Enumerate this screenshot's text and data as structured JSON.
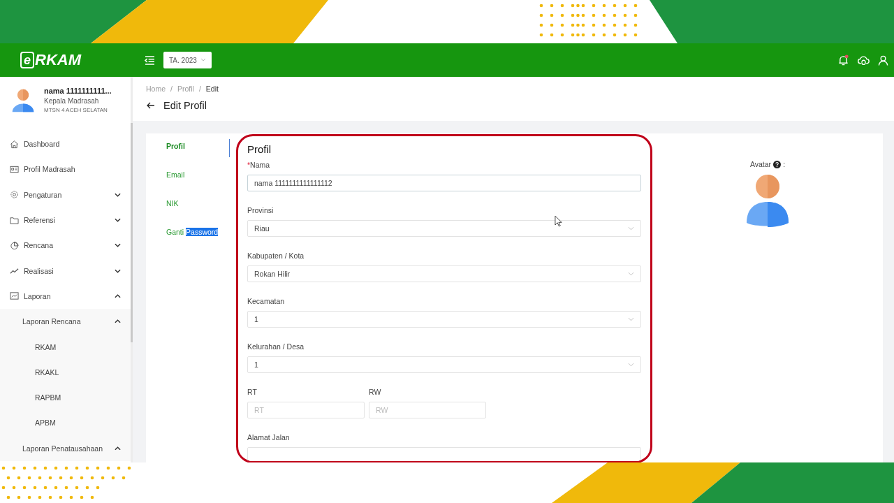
{
  "header": {
    "logo_mark": "e",
    "logo_text": "RKAM",
    "year_select": "TA. 2023",
    "notification_unread": true
  },
  "user": {
    "name": "nama 1111111111...",
    "role": "Kepala Madrasah",
    "school": "MTSN 4 ACEH SELATAN"
  },
  "sidebar": {
    "items": [
      {
        "label": "Dashboard",
        "kind": "link"
      },
      {
        "label": "Profil Madrasah",
        "kind": "link"
      },
      {
        "label": "Pengaturan",
        "kind": "group",
        "expanded": false
      },
      {
        "label": "Referensi",
        "kind": "group",
        "expanded": false
      },
      {
        "label": "Rencana",
        "kind": "group",
        "expanded": false
      },
      {
        "label": "Realisasi",
        "kind": "group",
        "expanded": false
      },
      {
        "label": "Laporan",
        "kind": "group",
        "expanded": true,
        "children": [
          {
            "label": "Laporan Rencana",
            "kind": "group",
            "expanded": true,
            "children": [
              {
                "label": "RKAM"
              },
              {
                "label": "RKAKL"
              },
              {
                "label": "RAPBM"
              },
              {
                "label": "APBM"
              }
            ]
          },
          {
            "label": "Laporan Penatausahaan",
            "kind": "group",
            "expanded": true
          }
        ]
      }
    ]
  },
  "breadcrumb": [
    "Home",
    "Profil",
    "Edit"
  ],
  "breadcrumb_separator": "/",
  "page_title": "Edit Profil",
  "tabs": [
    {
      "label": "Profil",
      "selected": true
    },
    {
      "label": "Email",
      "selected": false
    },
    {
      "label": "NIK",
      "selected": false
    },
    {
      "label": "Ganti",
      "highlighted": "Password",
      "selected": false
    }
  ],
  "form": {
    "title": "Profil",
    "focus_frame": true,
    "required_mark": "*",
    "fields": [
      {
        "kind": "text",
        "label": "Nama",
        "required": true,
        "value": "nama 1111111111111112"
      },
      {
        "kind": "select",
        "label": "Provinsi",
        "required": false,
        "value": "Riau"
      },
      {
        "kind": "select",
        "label": "Kabupaten / Kota",
        "required": false,
        "value": "Rokan Hilir"
      },
      {
        "kind": "select",
        "label": "Kecamatan",
        "required": false,
        "value": "1"
      },
      {
        "kind": "select",
        "label": "Kelurahan / Desa",
        "required": false,
        "value": "1"
      },
      {
        "kind": "pair",
        "items": [
          {
            "label": "RT",
            "placeholder": "RT"
          },
          {
            "label": "RW",
            "placeholder": "RW"
          }
        ]
      },
      {
        "kind": "text",
        "label": "Alamat Jalan",
        "required": false
      }
    ]
  },
  "avatar": {
    "label": "Avatar",
    "suffix": ":"
  }
}
